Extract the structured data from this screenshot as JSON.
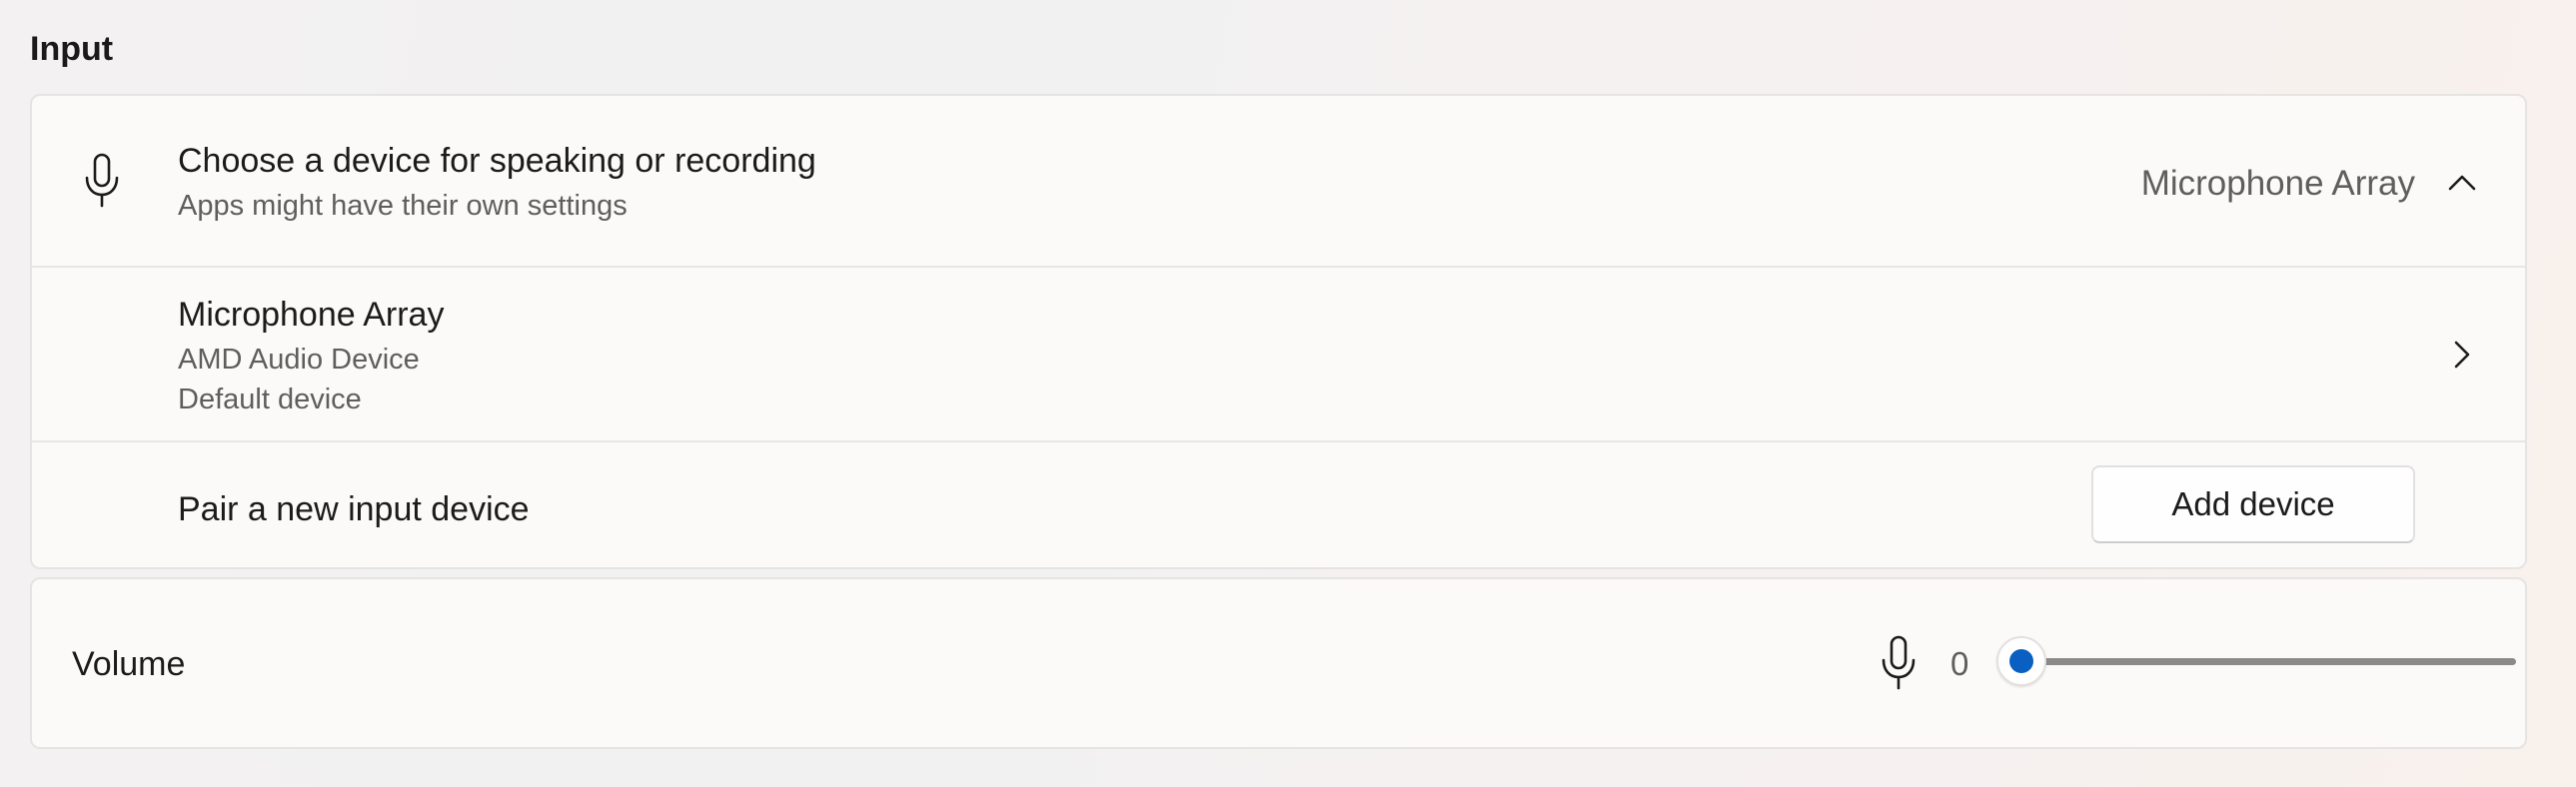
{
  "section": {
    "title": "Input"
  },
  "device_chooser": {
    "title": "Choose a device for speaking or recording",
    "subtitle": "Apps might have their own settings",
    "selected_value": "Microphone Array",
    "icon": "microphone-icon",
    "expand_icon": "chevron-up-icon"
  },
  "device": {
    "name": "Microphone Array",
    "driver": "AMD Audio Device",
    "status": "Default device",
    "nav_icon": "chevron-right-icon"
  },
  "pair": {
    "label": "Pair a new input device",
    "button_label": "Add device"
  },
  "volume": {
    "label": "Volume",
    "value_text": "0",
    "level": 0,
    "max": 100,
    "icon": "microphone-icon"
  },
  "colors": {
    "accent": "#0a5fc2",
    "card_background": "#fbfaf9",
    "secondary_text": "#5e5e5e"
  }
}
